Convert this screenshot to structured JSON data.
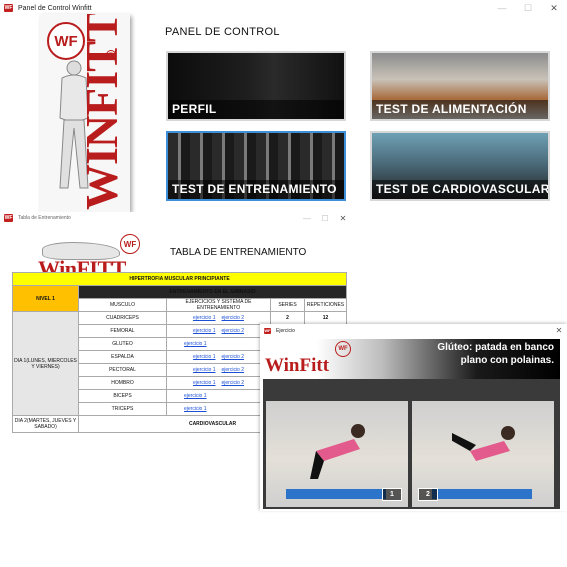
{
  "panel_window": {
    "title": "Panel de Control Winfitt",
    "app_icon": "WF",
    "controls": {
      "minimize": "—",
      "maximize": "☐",
      "close": "✕"
    },
    "brand": {
      "badge": "WF",
      "wordmark": "WINFITT",
      "registered": "R"
    },
    "heading": "PANEL DE CONTROL",
    "tiles": [
      {
        "label": "PERFIL"
      },
      {
        "label": "TEST DE ALIMENTACIÓN"
      },
      {
        "label": "TEST DE ENTRENAMIENTO"
      },
      {
        "label": "TEST DE CARDIOVASCULAR"
      }
    ]
  },
  "tabla_window": {
    "title": "Tabla de Entrenamiento",
    "controls": {
      "minimize": "—",
      "maximize": "☐",
      "close": "✕"
    },
    "logo": {
      "wordmark": "WinFITT",
      "badge": "WF"
    },
    "heading": "TABLA DE ENTRENAMIENTO",
    "table": {
      "banner": "HIPERTROFIA MUSCULAR PRINCIPIANTE",
      "level": "NIVEL 1",
      "gym_header": "ENTRENAMIENTO EN EL GIMNASIO",
      "columns": [
        "MUSCULO",
        "EJERCICIOS Y SISTEMA DE ENTRENAMIENTO",
        "SERIES",
        "REPETICIONES"
      ],
      "day1": "DIA 1(LUNES, MIERCOLES Y VIERNES)",
      "day2": "DIA 2(MARTES, JUEVES Y SABADO)",
      "day2_activity": "CARDIOVASCULAR",
      "link1": "ejercicio 1",
      "link2": "ejercicio 2",
      "rows": [
        {
          "muscle": "CUADRICEPS",
          "series": "2",
          "reps": "12"
        },
        {
          "muscle": "FEMORAL",
          "series": "",
          "reps": ""
        },
        {
          "muscle": "GLUTEO",
          "series": "",
          "reps": ""
        },
        {
          "muscle": "ESPALDA",
          "series": "",
          "reps": ""
        },
        {
          "muscle": "PECTORAL",
          "series": "",
          "reps": ""
        },
        {
          "muscle": "HOMBRO",
          "series": "",
          "reps": ""
        },
        {
          "muscle": "BICEPS",
          "series": "",
          "reps": ""
        },
        {
          "muscle": "TRICEPS",
          "series": "",
          "reps": ""
        }
      ]
    }
  },
  "ejercicio_window": {
    "title": "Ejercicio",
    "controls": {
      "close": "✕"
    },
    "logo": {
      "wordmark": "WinFitt",
      "badge": "WF"
    },
    "exercise_title": "Glúteo: patada en banco plano con polainas.",
    "steps": [
      "1",
      "2"
    ]
  }
}
